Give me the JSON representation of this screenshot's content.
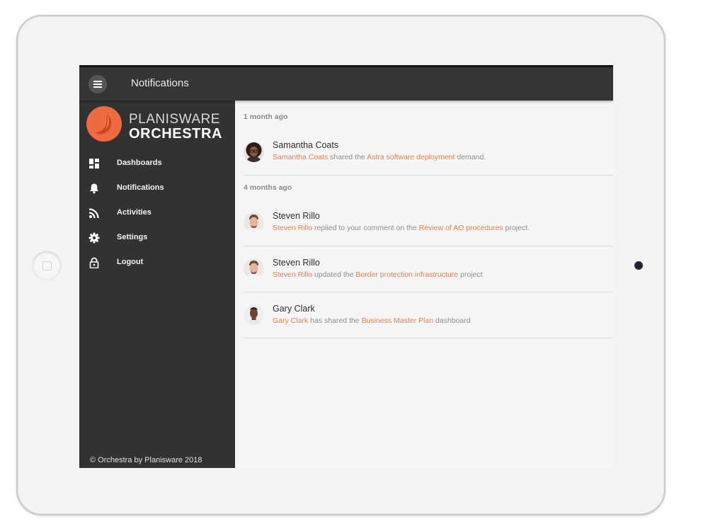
{
  "header": {
    "title": "Notifications"
  },
  "brand": {
    "line1": "PLANISWARE",
    "line2": "ORCHESTRA",
    "accent_color": "#ef6a3e"
  },
  "sidebar": {
    "items": [
      {
        "label": "Dashboards",
        "icon": "dashboard-icon"
      },
      {
        "label": "Notifications",
        "icon": "bell-icon"
      },
      {
        "label": "Activities",
        "icon": "rss-icon"
      },
      {
        "label": "Settings",
        "icon": "gear-icon"
      },
      {
        "label": "Logout",
        "icon": "lock-icon"
      }
    ],
    "footer": "© Orchestra by Planisware 2018"
  },
  "groups": [
    {
      "label": "1 month ago",
      "notifications": [
        {
          "name": "Samantha Coats",
          "actor": "Samantha Coats",
          "verb": "shared the",
          "object": "Astra software deployment",
          "suffix": "demand."
        }
      ]
    },
    {
      "label": "4 months ago",
      "notifications": [
        {
          "name": "Steven Rillo",
          "actor": "Steven Rillo",
          "verb": "replied to your comment on the",
          "object": "Review of AO procedures",
          "suffix": "project."
        },
        {
          "name": "Steven Rillo",
          "actor": "Steven Rillo",
          "verb": "updated the",
          "object": "Border protection infrastructure",
          "suffix": "project"
        },
        {
          "name": "Gary Clark",
          "actor": "Gary Clark",
          "verb": "has shared the",
          "object": "Business Master Plan",
          "suffix": "dashboard"
        }
      ]
    }
  ],
  "colors": {
    "link": "#ea7b4b",
    "topbar": "#353535",
    "sidebar": "#323232",
    "content": "#f5f5f5"
  }
}
